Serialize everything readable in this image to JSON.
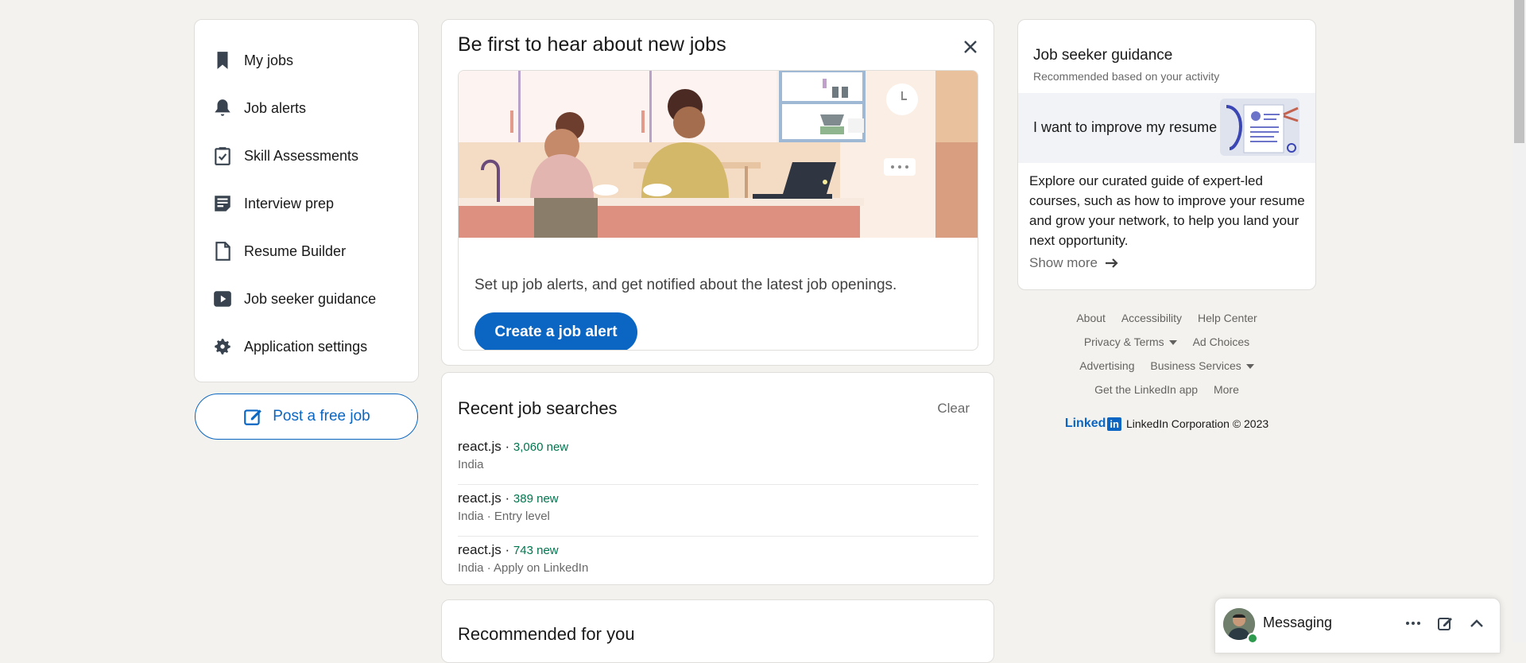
{
  "left_nav": {
    "items": [
      {
        "label": "My jobs",
        "icon": "bookmark-icon"
      },
      {
        "label": "Job alerts",
        "icon": "bell-icon"
      },
      {
        "label": "Skill Assessments",
        "icon": "clipboard-check-icon"
      },
      {
        "label": "Interview prep",
        "icon": "note-icon"
      },
      {
        "label": "Resume Builder",
        "icon": "document-icon"
      },
      {
        "label": "Job seeker guidance",
        "icon": "video-play-icon"
      },
      {
        "label": "Application settings",
        "icon": "gear-icon"
      }
    ],
    "post_job_label": "Post a free job"
  },
  "alert_card": {
    "title": "Be first to hear about new jobs",
    "description": "Set up job alerts, and get notified about the latest job openings.",
    "button_label": "Create a job alert"
  },
  "recent_searches": {
    "title": "Recent job searches",
    "clear_label": "Clear",
    "items": [
      {
        "query": "react.js",
        "sep": " · ",
        "new_count": "3,060 new",
        "detail": "India"
      },
      {
        "query": "react.js",
        "sep": " · ",
        "new_count": "389 new",
        "detail": "India · Entry level"
      },
      {
        "query": "react.js",
        "sep": " · ",
        "new_count": "743 new",
        "detail": "India · Apply on LinkedIn"
      }
    ]
  },
  "recommended": {
    "title": "Recommended for you"
  },
  "guidance": {
    "title": "Job seeker guidance",
    "subtitle": "Recommended based on your activity",
    "banner_text": "I want to improve my resume",
    "body": "Explore our curated guide of expert-led courses, such as how to improve your resume and grow your network, to help you land your next opportunity.",
    "show_more": "Show more"
  },
  "footer": {
    "links_row1": [
      "About",
      "Accessibility",
      "Help Center"
    ],
    "privacy_terms": "Privacy & Terms",
    "ad_choices": "Ad Choices",
    "advertising": "Advertising",
    "business_services": "Business Services",
    "get_app": "Get the LinkedIn app",
    "more": "More",
    "logo_text": "Linked",
    "logo_in": "in",
    "copyright": "LinkedIn Corporation © 2023"
  },
  "messaging": {
    "label": "Messaging"
  },
  "colors": {
    "brand_blue": "#0a66c2",
    "new_count_green": "#01754f",
    "page_background": "#f4f2ee"
  }
}
